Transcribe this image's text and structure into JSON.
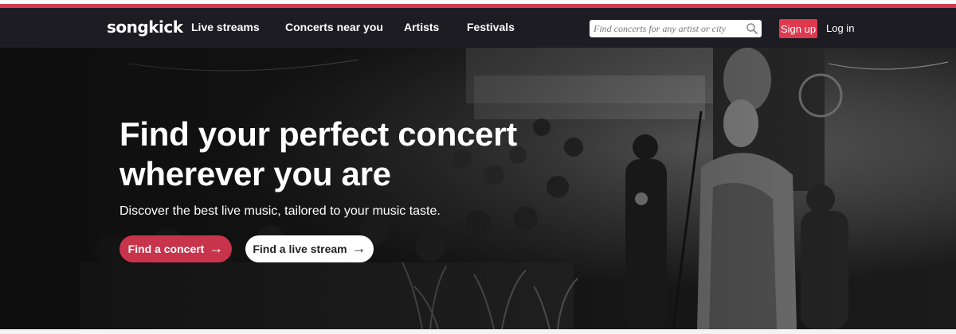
{
  "brand": {
    "logo": "songkick",
    "accent_color": "#d43a4f",
    "header_bg": "#1c1c22"
  },
  "nav": {
    "items": [
      {
        "label": "Live streams"
      },
      {
        "label": "Concerts near you"
      },
      {
        "label": "Artists"
      },
      {
        "label": "Festivals"
      }
    ]
  },
  "search": {
    "placeholder": "Find concerts for any artist or city",
    "icon": "search-icon"
  },
  "auth": {
    "signup_label": "Sign up",
    "login_label": "Log in"
  },
  "hero": {
    "headline_line1": "Find your perfect concert",
    "headline_line2": "wherever you are",
    "tagline": "Discover the best live music, tailored to your music taste.",
    "primary_button": {
      "label": "Find a concert",
      "icon": "arrow-right-icon",
      "color": "#c8344b"
    },
    "secondary_button": {
      "label": "Find a live stream",
      "icon": "arrow-right-icon",
      "color": "#ffffff"
    },
    "background": "monochrome photo of a live performance with singers and crowd"
  }
}
